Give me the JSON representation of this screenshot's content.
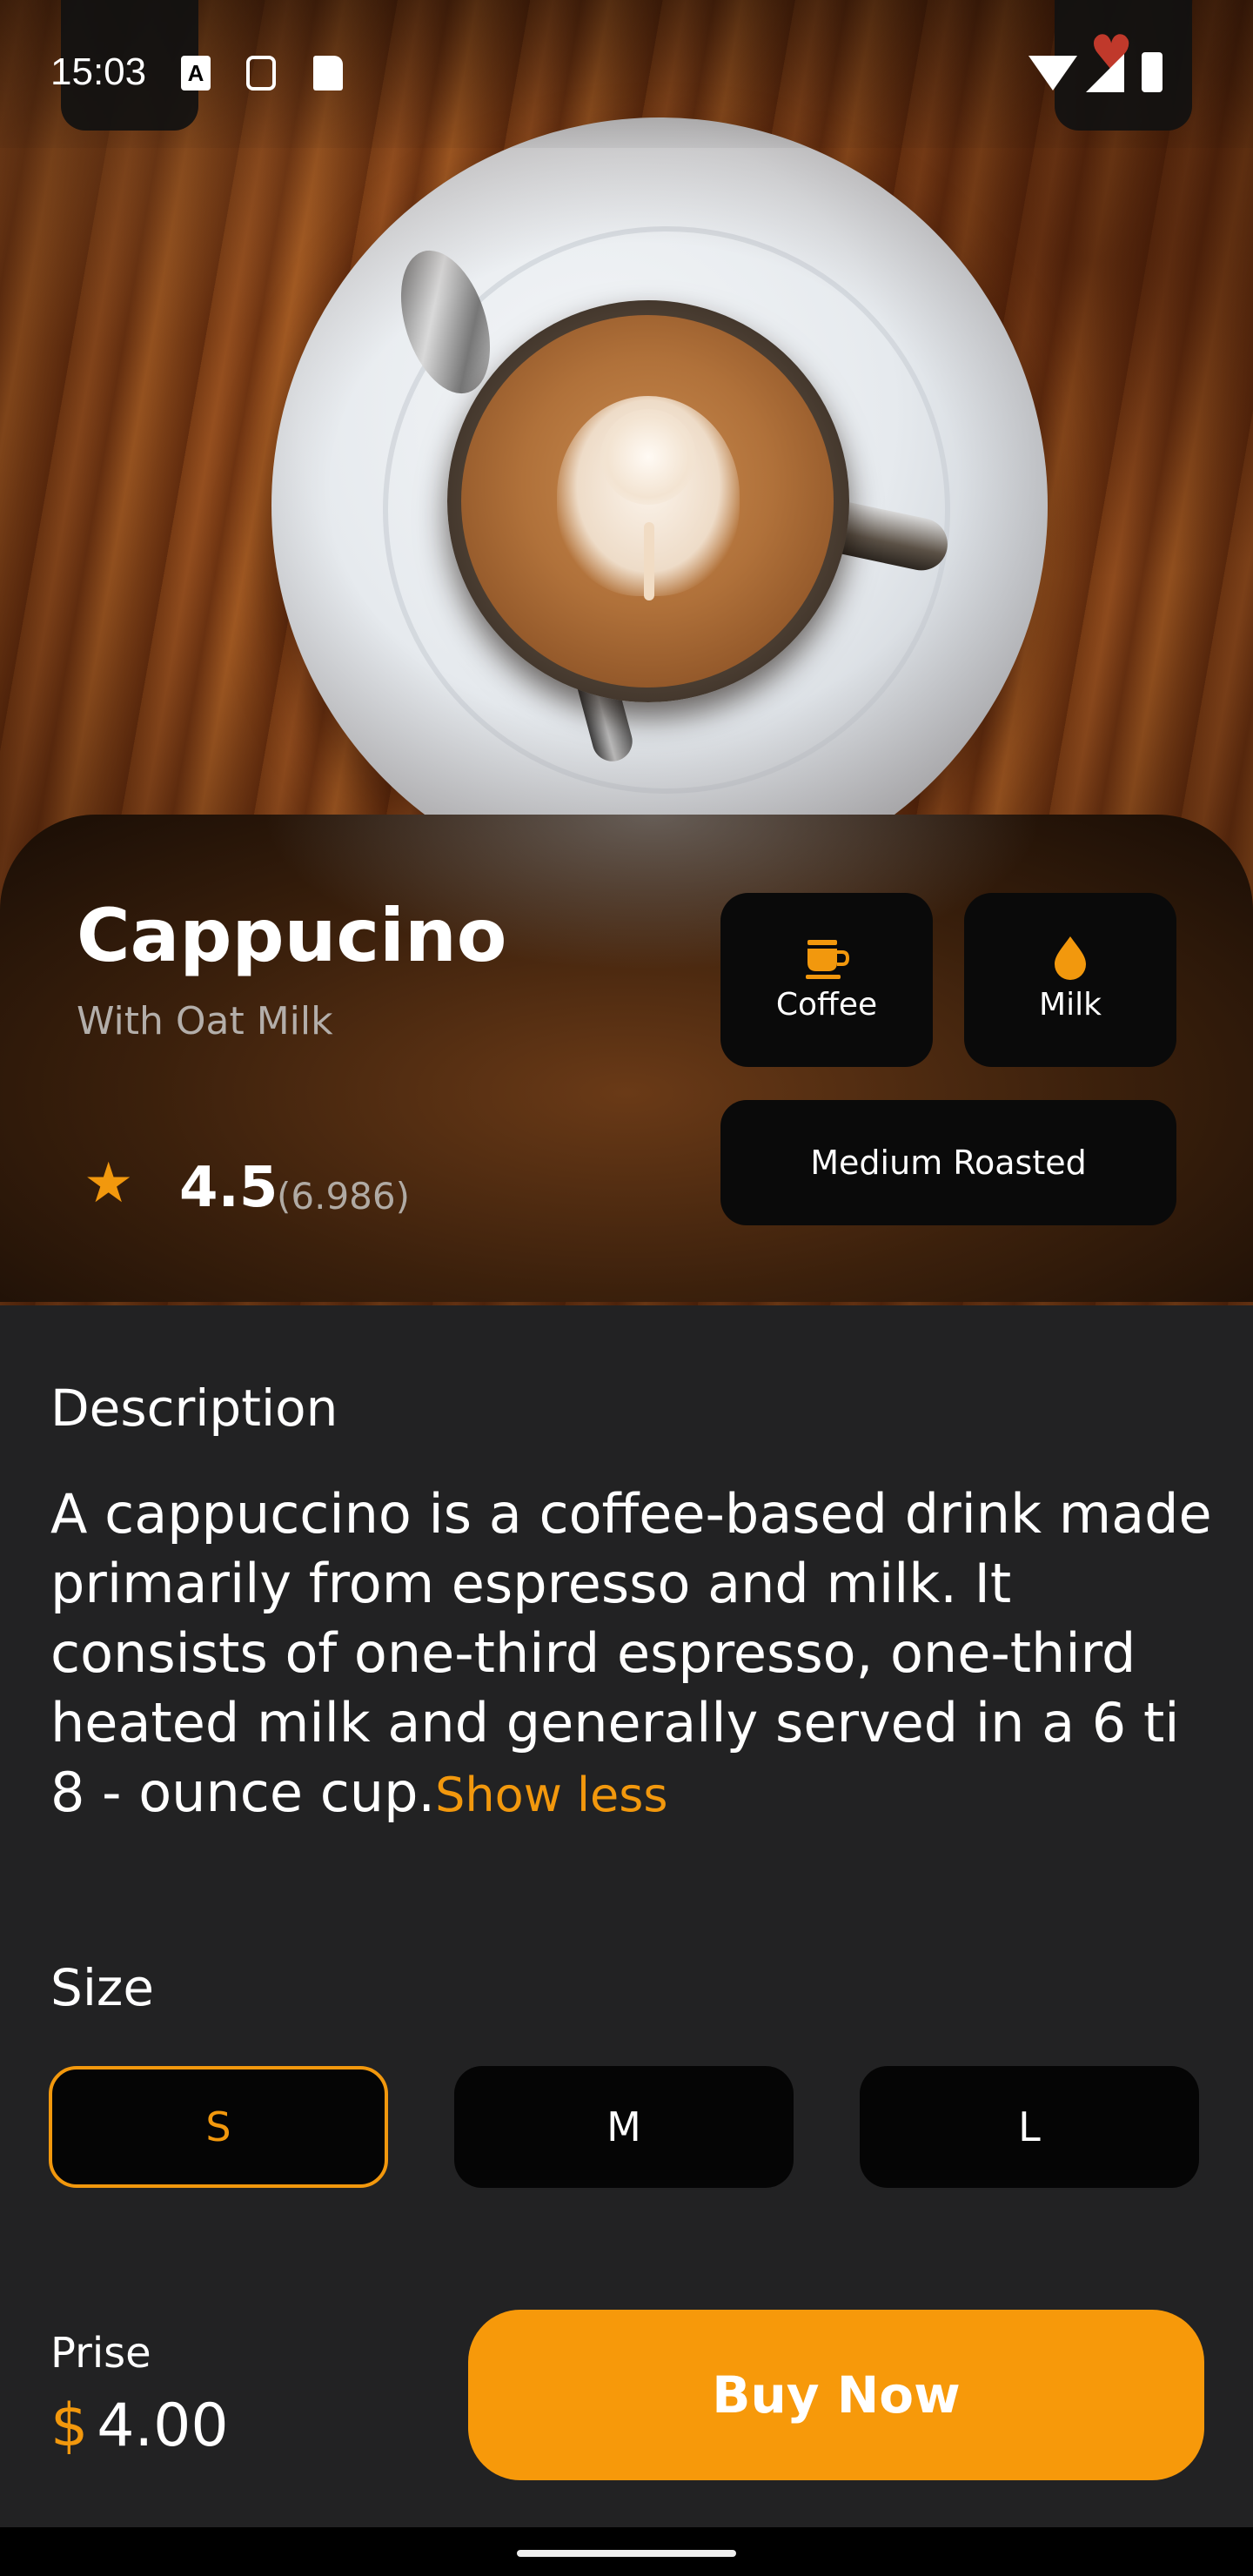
{
  "status_bar": {
    "time": "15:03",
    "icons": [
      "keyboard-a-icon",
      "settings-icon",
      "sd-card-icon",
      "wifi-icon",
      "signal-icon",
      "battery-icon",
      "heart-icon"
    ]
  },
  "product": {
    "name": "Cappucino",
    "subtitle": "With Oat Milk",
    "rating": "4.5",
    "rating_count": "(6.986)",
    "tags": {
      "coffee": "Coffee",
      "milk": "Milk",
      "roast": "Medium Roasted"
    }
  },
  "description": {
    "heading": "Description",
    "text": "A cappuccino is a coffee-based drink made primarily from espresso and milk. It consists of one-third espresso, one-third heated milk and generally served in a 6 ti 8 - ounce cup.",
    "toggle": "Show less"
  },
  "size": {
    "heading": "Size",
    "options": [
      "S",
      "M",
      "L"
    ],
    "selected": "S"
  },
  "purchase": {
    "price_label": "Prise",
    "currency": "$",
    "price": "4.00",
    "buy_label": "Buy Now"
  },
  "colors": {
    "accent": "#f2980d",
    "background": "#222223",
    "chip": "#0a0a0a"
  }
}
